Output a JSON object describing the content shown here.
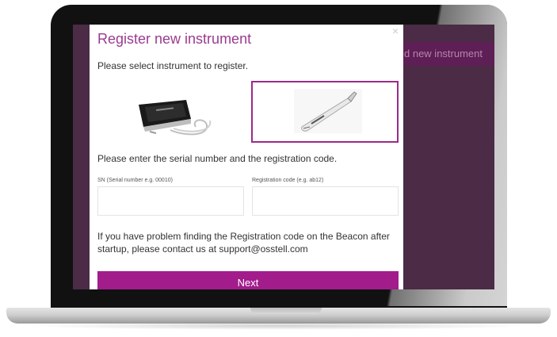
{
  "background_app": {
    "add_instrument_button": "d new instrument"
  },
  "modal": {
    "title": "Register new instrument",
    "close_icon": "close-icon",
    "select_prompt": "Please select instrument to register.",
    "instrument_options": [
      {
        "icon": "device-console-image",
        "selected": false
      },
      {
        "icon": "beacon-probe-image",
        "selected": true
      }
    ],
    "serial_prompt": "Please enter the serial number and the registration code.",
    "serial_field": {
      "label": "SN (Serial number e.g. 00010)",
      "value": ""
    },
    "code_field": {
      "label": "Registration code (e.g. ab12)",
      "value": ""
    },
    "help_text": "If you have problem finding the Registration code on the Beacon after startup, please contact us at support@osstell.com",
    "next_button": "Next"
  },
  "colors": {
    "accent": "#a21c8c",
    "title": "#9b3a8f",
    "backdrop": "#4b2b45"
  }
}
